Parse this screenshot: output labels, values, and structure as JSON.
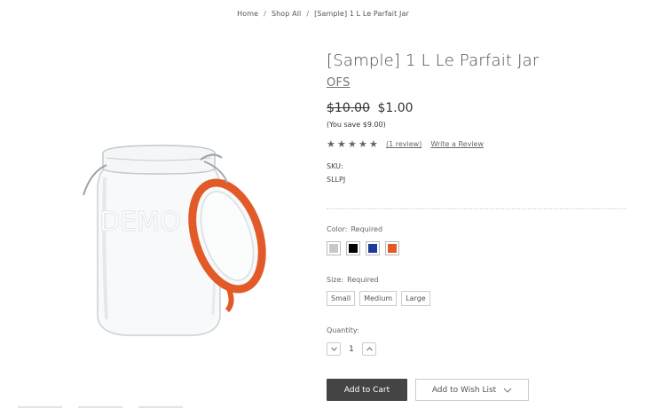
{
  "breadcrumbs": [
    "Home",
    "Shop All",
    "[Sample] 1 L Le Parfait Jar"
  ],
  "breadcrumb_separator": "/",
  "product": {
    "title": "[Sample] 1 L Le Parfait Jar",
    "brand": "OFS",
    "price_old": "$10.00",
    "price_new": "$1.00",
    "savings": "(You save $9.00)",
    "rating_stars": 5,
    "review_count": "(1 review)",
    "write_review": "Write a Review",
    "sku_label": "SKU:",
    "sku_value": "SLLPJ",
    "image_watermark": "DEMO"
  },
  "options": {
    "color_label": "Color:",
    "color_required": "Required",
    "colors": [
      {
        "name": "silver",
        "hex": "#c8c8c8"
      },
      {
        "name": "black",
        "hex": "#000000"
      },
      {
        "name": "blue",
        "hex": "#1f3a9a"
      },
      {
        "name": "orange",
        "hex": "#e25a28"
      }
    ],
    "size_label": "Size:",
    "size_required": "Required",
    "sizes": [
      "Small",
      "Medium",
      "Large"
    ],
    "quantity_label": "Quantity:",
    "quantity_value": "1"
  },
  "actions": {
    "add_to_cart": "Add to Cart",
    "add_to_wishlist": "Add to Wish List"
  },
  "icons": {
    "star": "star-icon",
    "minus": "chevron-down-icon",
    "plus": "chevron-up-icon",
    "wishlist_dropdown": "chevron-down-icon"
  }
}
